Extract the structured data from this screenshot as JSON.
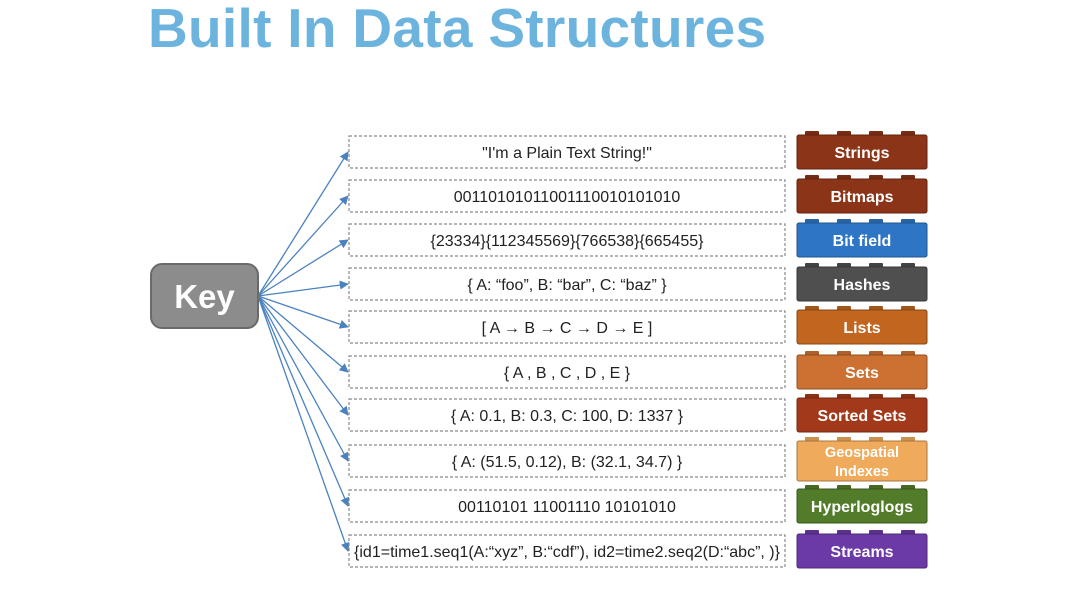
{
  "title": "Built In Data Structures",
  "key": {
    "label": "Key"
  },
  "values": [
    "\"I'm a Plain Text String!\"",
    "00110101011001110010101010",
    "{23334}{112345569}{766538}{665455}",
    "{ A: “foo”, B: “bar”, C: “baz”  }",
    "[ A → B → C → D → E ]",
    "{  A , B , C , D , E  }",
    "{ A: 0.1, B: 0.3, C: 100, D: 1337 }",
    "{ A: (51.5, 0.12), B: (32.1, 34.7)  }",
    "00110101 11001110 10101010",
    "{id1=time1.seq1(A:“xyz”, B:“cdf”), id2=time2.seq2(D:“abc”, )}"
  ],
  "types": [
    {
      "lines": [
        "Strings"
      ],
      "color": "#8b3417"
    },
    {
      "lines": [
        "Bitmaps"
      ],
      "color": "#8b3417"
    },
    {
      "lines": [
        "Bit field"
      ],
      "color": "#2e76c5"
    },
    {
      "lines": [
        "Hashes"
      ],
      "color": "#4f4f4f"
    },
    {
      "lines": [
        "Lists"
      ],
      "color": "#c1651f"
    },
    {
      "lines": [
        "Sets"
      ],
      "color": "#cc7132"
    },
    {
      "lines": [
        "Sorted Sets"
      ],
      "color": "#a3391b"
    },
    {
      "lines": [
        "Geospatial",
        "Indexes"
      ],
      "color": "#f0aa5c"
    },
    {
      "lines": [
        "Hyperloglogs"
      ],
      "color": "#527b2a"
    },
    {
      "lines": [
        "Streams"
      ],
      "color": "#6b3aa6"
    }
  ],
  "colors": {
    "title": "#6cb4de",
    "key_fill": "#8c8c8c",
    "arrow": "#4a82c0",
    "box_border": "#8a8a8a"
  }
}
